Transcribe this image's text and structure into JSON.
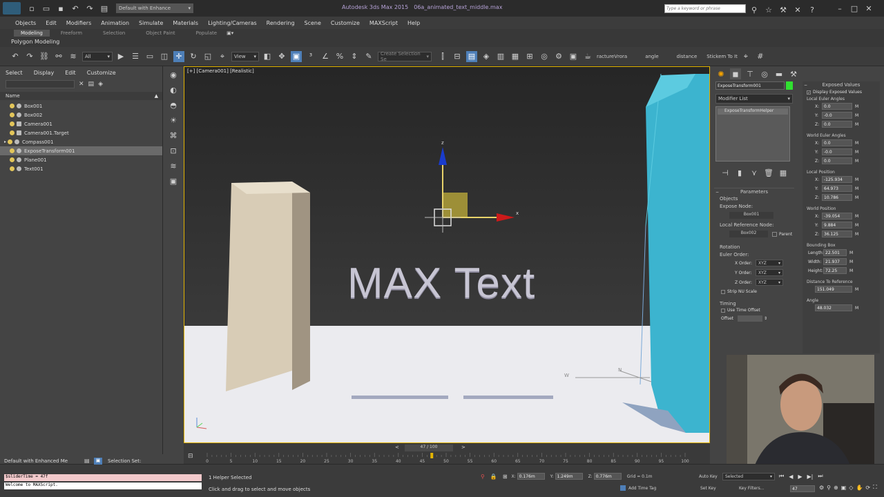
{
  "app": {
    "workspace": "Default with Enhance",
    "title": "Autodesk 3ds Max 2015",
    "file": "06a_animated_text_middle.max",
    "search_placeholder": "Type a keyword or phrase"
  },
  "menu": [
    "Objects",
    "Edit",
    "Modifiers",
    "Animation",
    "Simulate",
    "Materials",
    "Lighting/Cameras",
    "Rendering",
    "Scene",
    "Customize",
    "MAXScript",
    "Help"
  ],
  "ribbon_tabs": [
    "Modeling",
    "Freeform",
    "Selection",
    "Object Paint",
    "Populate"
  ],
  "ribbon_panel": "Polygon Modeling",
  "toolbar": {
    "filter": "All",
    "ref_coord": "View",
    "named_sel": "Create Selection Se",
    "extra": [
      "ractureVrora",
      "angle",
      "distance",
      "Stickem To It"
    ]
  },
  "explorer": {
    "menus": [
      "Select",
      "Display",
      "Edit",
      "Customize"
    ],
    "name_header": "Name",
    "items": [
      "Box001",
      "Box002",
      "Camera001",
      "Camera001.Target",
      "Compass001",
      "ExposeTransform001",
      "Plane001",
      "Text001"
    ],
    "selected_index": 5,
    "workspace": "Default with Enhanced Me",
    "selection_set": "Selection Set:"
  },
  "viewport": {
    "label": "[+] [Camera001] [Realistic]",
    "text": "MAX Text",
    "gizmo": {
      "z": "z",
      "x": "x"
    }
  },
  "command_panel": {
    "object_name": "ExposeTransform001",
    "modifier_list": "Modifier List",
    "stack_item": "ExposeTransformHelper",
    "parameters": {
      "title": "Parameters",
      "objects": "Objects",
      "expose_node_label": "Expose Node:",
      "expose_node": "Box001",
      "ref_node_label": "Local Reference Node:",
      "ref_node": "Box002",
      "parent_label": "Parent",
      "rotation": "Rotation",
      "euler_order": "Euler Order:",
      "x_order_label": "X Order:",
      "x_order": "XYZ",
      "y_order_label": "Y Order:",
      "y_order": "XYZ",
      "z_order_label": "Z Order:",
      "z_order": "XYZ",
      "strip_nu": "Strip NU Scale",
      "timing": "Timing",
      "use_time_offset": "Use Time Offset",
      "offset_label": "Offset"
    },
    "exposed": {
      "title": "Exposed Values",
      "display": "Display Exposed Values",
      "local_euler": "Local Euler Angles",
      "local_euler_vals": [
        "0.0",
        "-0.0",
        "0.0"
      ],
      "world_euler": "World Euler Angles",
      "world_euler_vals": [
        "0.0",
        "-0.0",
        "0.0"
      ],
      "local_pos": "Local Position",
      "local_pos_vals": [
        "-125.934",
        "64.973",
        "10.786"
      ],
      "world_pos": "World Position",
      "world_pos_vals": [
        "-39.054",
        "9.884",
        "36.125"
      ],
      "bbox": "Bounding Box",
      "length_label": "Length:",
      "length": "22.501",
      "width_label": "Width:",
      "width": "21.937",
      "height_label": "Height:",
      "height": "72.25",
      "distance": "Distance To Reference",
      "distance_val": "151.049",
      "angle": "Angle",
      "angle_val": "48.032",
      "axis_x": "X:",
      "axis_y": "Y:",
      "axis_z": "Z:"
    }
  },
  "timeline": {
    "frame": "47 / 100",
    "ticks": [
      "0",
      "5",
      "10",
      "15",
      "20",
      "25",
      "30",
      "35",
      "40",
      "45",
      "50",
      "55",
      "60",
      "65",
      "70",
      "75",
      "80",
      "85",
      "90",
      "95",
      "100"
    ],
    "current": 47,
    "total": 100
  },
  "status": {
    "script_line1": "$sliderTime = 47f",
    "script_line2": "Welcome to MAXScript.",
    "selected": "1 Helper Selected",
    "prompt": "Click and drag to select and move objects",
    "x": "0.176m",
    "y": "1.249m",
    "z": "0.776m",
    "grid": "Grid = 0.1m",
    "add_time_tag": "Add Time Tag",
    "auto_key": "Auto Key",
    "selected_dd": "Selected",
    "set_key": "Set Key",
    "key_filters": "Key Filters...",
    "frame_field": "47"
  },
  "colors": {
    "accent": "#e3b400",
    "selection": "#6a6a6a",
    "blue_box": "#38b3cc"
  }
}
